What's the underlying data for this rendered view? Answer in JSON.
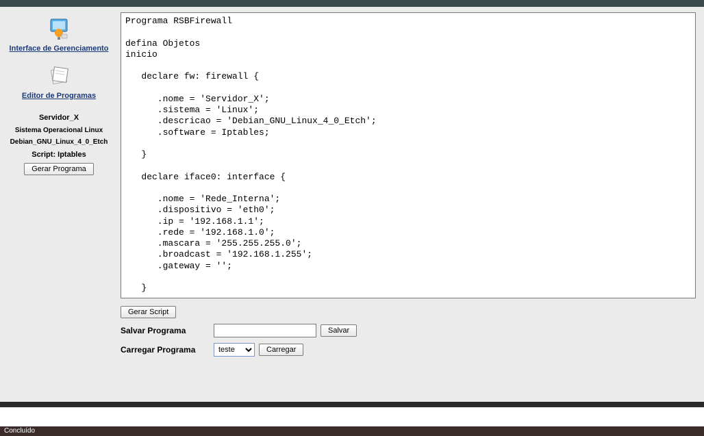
{
  "sidebar": {
    "interface_link": "Interface de Gerenciamento",
    "editor_link": "Editor de Programas",
    "server_name": "Servidor_X",
    "os_line1": "Sistema Operacional Linux",
    "os_line2": "Debian_GNU_Linux_4_0_Etch",
    "script_label": "Script: Iptables",
    "gerar_programa_btn": "Gerar Programa"
  },
  "content": {
    "code": "Programa RSBFirewall\n\ndefina Objetos\ninicio\n\n   declare fw: firewall {\n\n      .nome = 'Servidor_X';\n      .sistema = 'Linux';\n      .descricao = 'Debian_GNU_Linux_4_0_Etch';\n      .software = Iptables;\n\n   }\n\n   declare iface0: interface {\n\n      .nome = 'Rede_Interna';\n      .dispositivo = 'eth0';\n      .ip = '192.168.1.1';\n      .rede = '192.168.1.0';\n      .mascara = '255.255.255.0';\n      .broadcast = '192.168.1.255';\n      .gateway = '';\n\n   }\n"
  },
  "controls": {
    "gerar_script_btn": "Gerar Script",
    "salvar_label": "Salvar Programa",
    "salvar_btn": "Salvar",
    "carregar_label": "Carregar Programa",
    "carregar_selected": "teste",
    "carregar_btn": "Carregar"
  },
  "status": {
    "text": "Concluído"
  }
}
